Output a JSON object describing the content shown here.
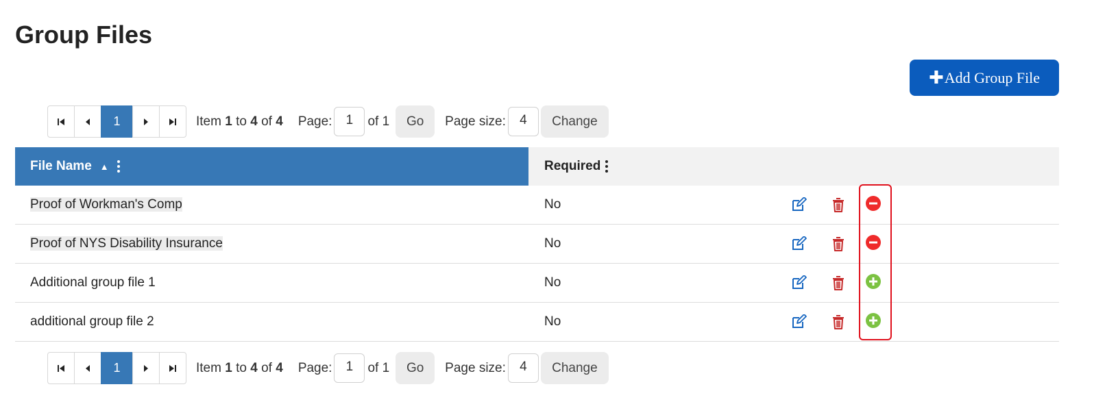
{
  "page": {
    "title": "Group Files"
  },
  "toolbar": {
    "add_label": "Add Group File",
    "add_icon": "plus-icon"
  },
  "pager": {
    "current_page": "1",
    "item_prefix": "Item",
    "item_from": "1",
    "item_to_word": "to",
    "item_to": "4",
    "item_of_word": "of",
    "item_total": "4",
    "page_label": "Page:",
    "page_value": "1",
    "page_of": "of 1",
    "go_label": "Go",
    "size_label": "Page size:",
    "size_value": "4",
    "change_label": "Change"
  },
  "grid": {
    "columns": [
      {
        "label": "File Name",
        "sorted": "ascending"
      },
      {
        "label": "Required"
      }
    ],
    "rows": [
      {
        "name": "Proof of Workman's Comp",
        "required": "No",
        "toggle": "remove",
        "highlighted": true
      },
      {
        "name": "Proof of NYS Disability Insurance",
        "required": "No",
        "toggle": "remove",
        "highlighted": true
      },
      {
        "name": "Additional group file 1",
        "required": "No",
        "toggle": "add",
        "highlighted": false
      },
      {
        "name": "additional group file 2",
        "required": "No",
        "toggle": "add",
        "highlighted": false
      }
    ]
  },
  "colors": {
    "header_blue": "#3778b6",
    "button_blue": "#0b5cbd",
    "edit_icon": "#1565c0",
    "delete_icon": "#c62828",
    "remove_icon": "#ef2b2b",
    "add_icon": "#7cc242",
    "highlight_box": "#e0101c"
  }
}
